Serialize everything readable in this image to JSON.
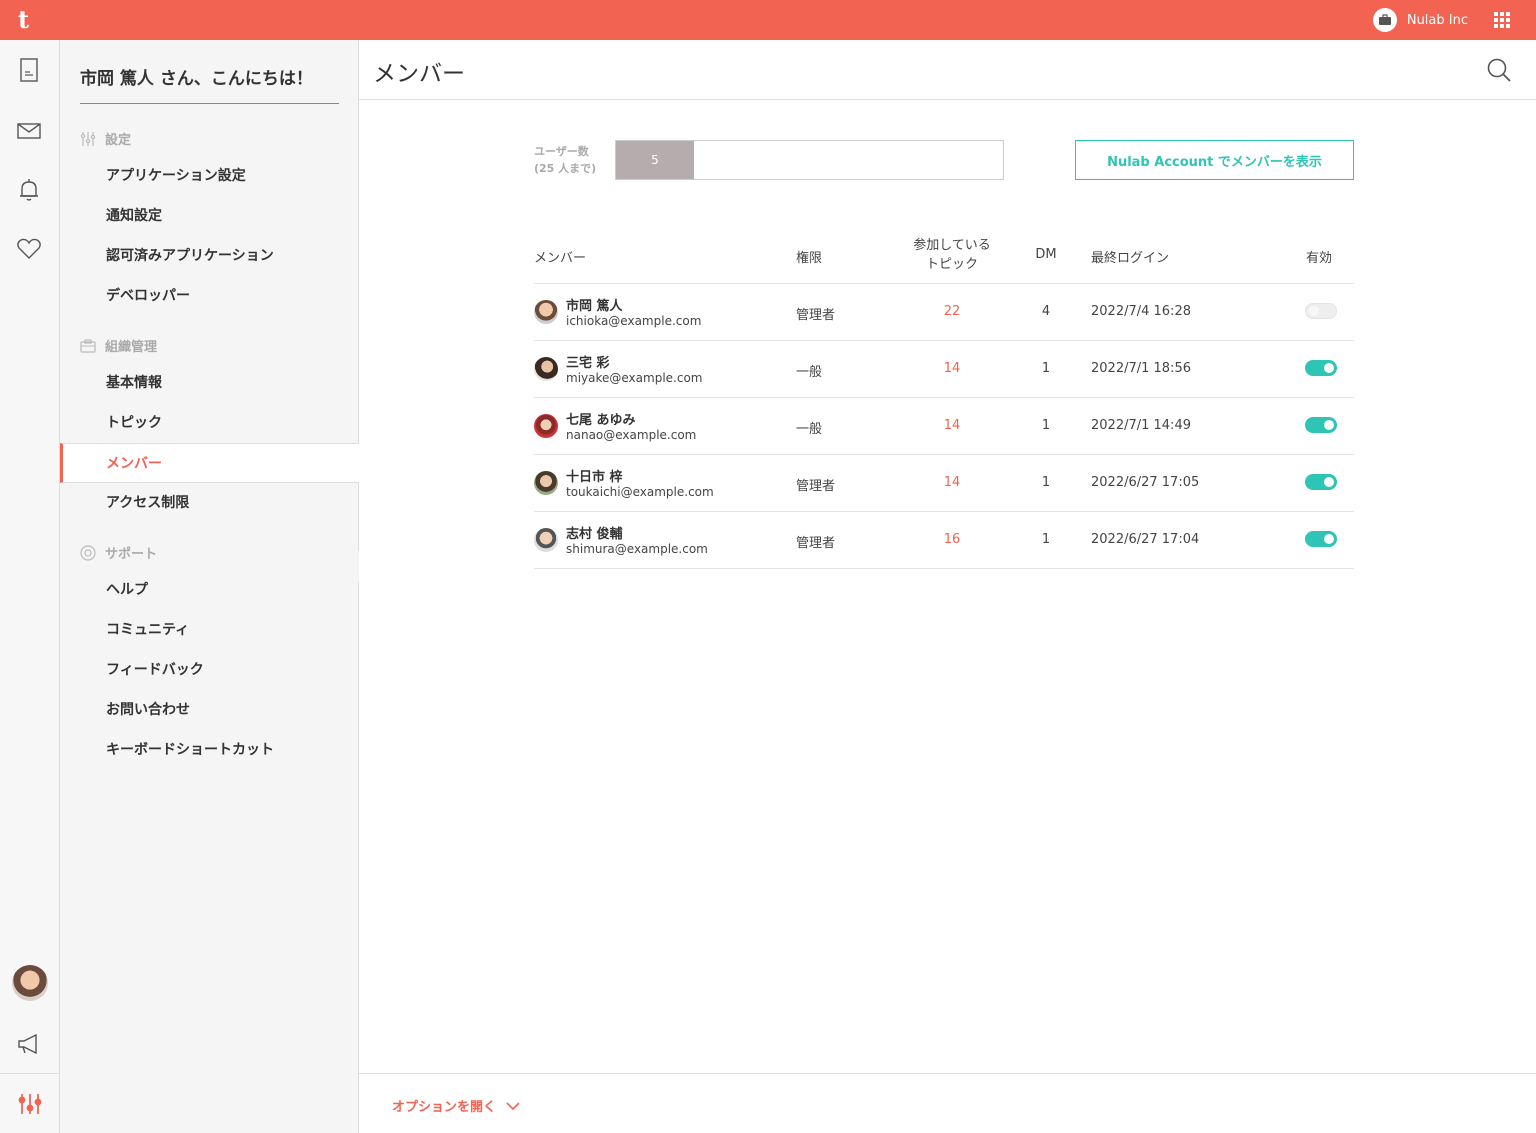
{
  "topbar": {
    "logo": "t",
    "org_name": "Nulab Inc"
  },
  "rail": {
    "icons": [
      "document-icon",
      "mail-icon",
      "bell-icon",
      "heart-icon",
      "avatar",
      "megaphone-icon",
      "settings-sliders-icon"
    ]
  },
  "sidebar": {
    "greeting": "市岡 篤人 さん、こんにちは！",
    "sections": [
      {
        "title": "設定",
        "icon": "sliders-icon",
        "items": [
          "アプリケーション設定",
          "通知設定",
          "認可済みアプリケーション",
          "デベロッパー"
        ]
      },
      {
        "title": "組織管理",
        "icon": "briefcase-icon",
        "items": [
          "基本情報",
          "トピック",
          "メンバー",
          "アクセス制限"
        ]
      },
      {
        "title": "サポート",
        "icon": "lifebuoy-icon",
        "items": [
          "ヘルプ",
          "コミュニティ",
          "フィードバック",
          "お問い合わせ",
          "キーボードショートカット"
        ]
      }
    ],
    "active_item": "メンバー"
  },
  "main": {
    "title": "メンバー",
    "users_label_1": "ユーザー数",
    "users_label_2": "(25 人まで)",
    "users_count": "5",
    "users_used": 5,
    "users_max": 25,
    "nulab_button": "Nulab Account でメンバーを表示",
    "columns": {
      "member": "メンバー",
      "role": "権限",
      "topics_1": "参加している",
      "topics_2": "トピック",
      "dm": "DM",
      "last_login": "最終ログイン",
      "enabled": "有効"
    },
    "members": [
      {
        "name": "市岡 篤人",
        "email": "ichioka@example.com",
        "role": "管理者",
        "topics": "22",
        "dm": "4",
        "last_login": "2022/7/4 16:28",
        "enabled": false
      },
      {
        "name": "三宅 彩",
        "email": "miyake@example.com",
        "role": "一般",
        "topics": "14",
        "dm": "1",
        "last_login": "2022/7/1 18:56",
        "enabled": true
      },
      {
        "name": "七尾 あゆみ",
        "email": "nanao@example.com",
        "role": "一般",
        "topics": "14",
        "dm": "1",
        "last_login": "2022/7/1 14:49",
        "enabled": true
      },
      {
        "name": "十日市 梓",
        "email": "toukaichi@example.com",
        "role": "管理者",
        "topics": "14",
        "dm": "1",
        "last_login": "2022/6/27 17:05",
        "enabled": true
      },
      {
        "name": "志村 俊輔",
        "email": "shimura@example.com",
        "role": "管理者",
        "topics": "16",
        "dm": "1",
        "last_login": "2022/6/27 17:04",
        "enabled": true
      }
    ],
    "footer_link": "オプションを開く"
  },
  "colors": {
    "brand": "#f26352",
    "accent": "#2ec4b6"
  }
}
